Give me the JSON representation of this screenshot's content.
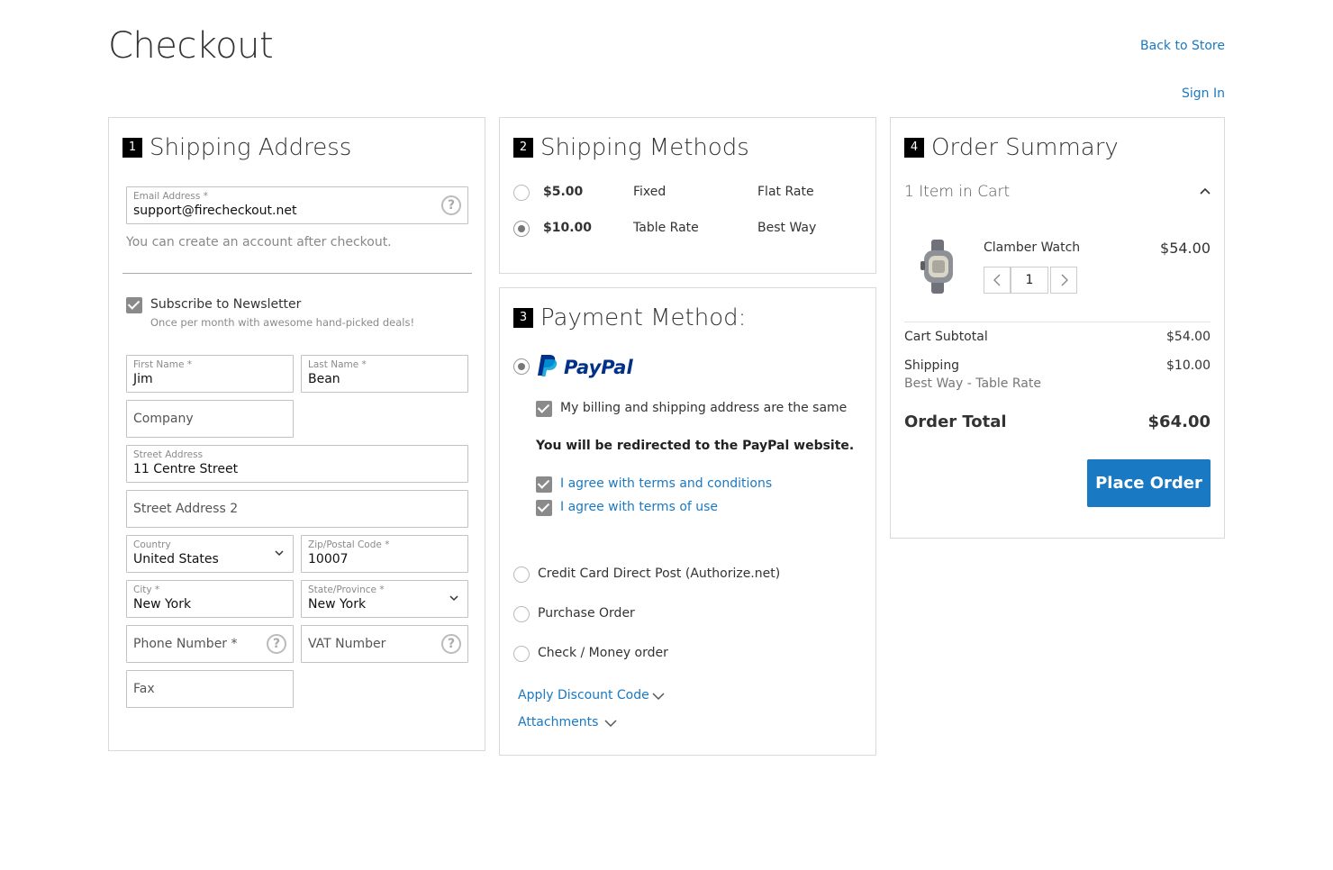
{
  "header": {
    "title": "Checkout",
    "back_to_store": "Back to Store",
    "sign_in": "Sign In"
  },
  "shipping_address": {
    "step": "1",
    "title": "Shipping Address",
    "email": {
      "label": "Email Address *",
      "value": "support@firecheckout.net"
    },
    "account_hint": "You can create an account after checkout.",
    "newsletter": {
      "label": "Subscribe to Newsletter",
      "hint": "Once per month with awesome hand-picked deals!",
      "checked": true
    },
    "first_name": {
      "label": "First Name *",
      "value": "Jim"
    },
    "last_name": {
      "label": "Last Name *",
      "value": "Bean"
    },
    "company": {
      "placeholder": "Company"
    },
    "street": {
      "label": "Street Address",
      "value": "11 Centre Street"
    },
    "street2": {
      "placeholder": "Street Address 2"
    },
    "country": {
      "label": "Country",
      "value": "United States"
    },
    "zip": {
      "label": "Zip/Postal Code *",
      "value": "10007"
    },
    "city": {
      "label": "City *",
      "value": "New York"
    },
    "state": {
      "label": "State/Province *",
      "value": "New York"
    },
    "phone": {
      "placeholder": "Phone Number *"
    },
    "vat": {
      "placeholder": "VAT Number"
    },
    "fax": {
      "placeholder": "Fax"
    }
  },
  "shipping_methods": {
    "step": "2",
    "title": "Shipping Methods",
    "options": [
      {
        "price": "$5.00",
        "method": "Fixed",
        "carrier": "Flat Rate",
        "selected": false
      },
      {
        "price": "$10.00",
        "method": "Table Rate",
        "carrier": "Best Way",
        "selected": true
      }
    ]
  },
  "payment": {
    "step": "3",
    "title": "Payment Method:",
    "paypal_logo_text": "PayPal",
    "same_address": "My billing and shipping address are the same",
    "redirect_note": "You will be redirected to the PayPal website.",
    "agree_terms": "I agree with terms and conditions",
    "agree_use": "I agree with terms of use",
    "other_methods": [
      "Credit Card Direct Post (Authorize.net)",
      "Purchase Order",
      "Check / Money order"
    ],
    "discount_link": "Apply Discount Code",
    "attachments_link": "Attachments"
  },
  "summary": {
    "step": "4",
    "title": "Order Summary",
    "items_in_cart": "1 Item in Cart",
    "item": {
      "name": "Clamber Watch",
      "price": "$54.00",
      "qty": "1"
    },
    "subtotal_label": "Cart Subtotal",
    "subtotal_value": "$54.00",
    "shipping_label": "Shipping",
    "shipping_method": "Best Way - Table Rate",
    "shipping_value": "$10.00",
    "total_label": "Order Total",
    "total_value": "$64.00",
    "place_order": "Place Order"
  },
  "colors": {
    "link": "#1979c3",
    "primary_button": "#1979c3",
    "step_badge": "#000000"
  }
}
